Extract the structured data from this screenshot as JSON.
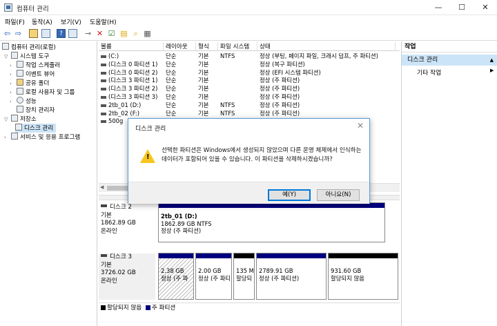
{
  "window": {
    "title": "컴퓨터 관리",
    "min": "—",
    "max": "☐",
    "close": "✕"
  },
  "menu": [
    "파일(F)",
    "동작(A)",
    "보기(V)",
    "도움말(H)"
  ],
  "tree": {
    "root": "컴퓨터 관리(로컬)",
    "system_tools": "시스템 도구",
    "items": [
      "작업 스케줄러",
      "이벤트 뷰어",
      "공유 폴더",
      "로컬 사용자 및 그룹",
      "성능",
      "장치 관리자"
    ],
    "storage": "저장소",
    "disk_mgmt": "디스크 관리",
    "services": "서비스 및 응용 프로그램"
  },
  "volume_table": {
    "headers": [
      "볼륨",
      "레이아웃",
      "형식",
      "파일 시스템",
      "상태"
    ],
    "rows": [
      [
        "(C:)",
        "단순",
        "기본",
        "NTFS",
        "정상 (부팅, 페이지 파일, 크래시 덤프, 주 파티션)"
      ],
      [
        "(디스크 0 파티션 1)",
        "단순",
        "기본",
        "",
        "정상 (복구 파티션)"
      ],
      [
        "(디스크 0 파티션 2)",
        "단순",
        "기본",
        "",
        "정상 (EFI 시스템 파티션)"
      ],
      [
        "(디스크 3 파티션 1)",
        "단순",
        "기본",
        "",
        "정상 (주 파티션)"
      ],
      [
        "(디스크 3 파티션 2)",
        "단순",
        "기본",
        "",
        "정상 (주 파티션)"
      ],
      [
        "(디스크 3 파티션 3)",
        "단순",
        "기본",
        "",
        "정상 (주 파티션)"
      ],
      [
        "2tb_01 (D:)",
        "단순",
        "기본",
        "NTFS",
        "정상 (주 파티션)"
      ],
      [
        "2tb_02 (F:)",
        "단순",
        "기본",
        "NTFS",
        "정상 (주 파티션)"
      ],
      [
        "500g",
        "",
        "",
        "",
        ""
      ]
    ]
  },
  "disks": {
    "disk2": {
      "name": "디스크 2",
      "type": "기본",
      "size": "1862.89 GB",
      "status": "온라인",
      "part": {
        "label": "2tb_01  (D:)",
        "size": "1862.89 GB NTFS",
        "state": "정상 (주 파티션)"
      }
    },
    "disk3": {
      "name": "디스크 3",
      "type": "기본",
      "size": "3726.02 GB",
      "status": "온라인",
      "parts": [
        {
          "size": "2.38 GB",
          "state": "정상 (주 파"
        },
        {
          "size": "2.00 GB",
          "state": "정상 (주 파티"
        },
        {
          "size": "135 M",
          "state": "할당되"
        },
        {
          "size": "2789.91 GB",
          "state": "정상 (주 파티션)"
        },
        {
          "size": "931.60 GB",
          "state": "할당되지 않음"
        }
      ]
    }
  },
  "legend": {
    "unallocated": "할당되지 않음",
    "primary": "주 파티션"
  },
  "actions": {
    "header": "작업",
    "section": "디스크 관리",
    "more": "기타 작업"
  },
  "dialog": {
    "title": "디스크 관리",
    "message": "선택한 파티션은 Windows에서 생성되지 않았으며 다른 운영 체제에서 인식하는 데이터가 포함되어 있을 수 있습니다. 이 파티션을 삭제하시겠습니까?",
    "yes": "예(Y)",
    "no": "아니요(N)"
  },
  "colors": {
    "primary_partition": "#00007f",
    "unallocated": "#000000",
    "selection": "#cce4f7",
    "accent": "#0078d7"
  }
}
